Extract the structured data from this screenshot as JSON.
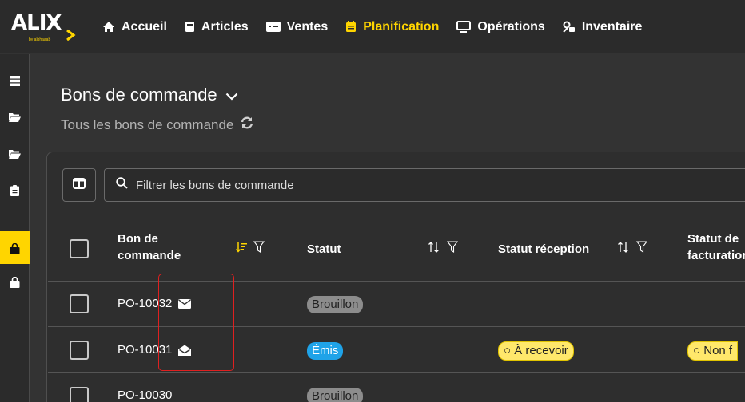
{
  "logo": {
    "text": "ALIX",
    "subtitle": "by alphaaab"
  },
  "nav": [
    {
      "label": "Accueil",
      "icon": "home-icon"
    },
    {
      "label": "Articles",
      "icon": "book-icon"
    },
    {
      "label": "Ventes",
      "icon": "sales-icon"
    },
    {
      "label": "Planification",
      "icon": "calendar-icon",
      "active": true
    },
    {
      "label": "Opérations",
      "icon": "monitor-icon"
    },
    {
      "label": "Inventaire",
      "icon": "inventory-icon"
    }
  ],
  "sidebar": {
    "items": [
      "list-icon",
      "folder-open-icon",
      "folder-open-icon",
      "clipboard-icon",
      "shopping-bag-icon",
      "shopping-bag-icon"
    ],
    "active_index": 4
  },
  "page": {
    "title": "Bons de commande",
    "subtitle": "Tous les bons de commande"
  },
  "filter": {
    "placeholder": "Filtrer les bons de commande"
  },
  "columns": [
    {
      "label": "Bon de commande"
    },
    {
      "label": "Statut"
    },
    {
      "label": "Statut réception"
    },
    {
      "label": "Statut de facturation"
    }
  ],
  "rows": [
    {
      "id": "PO-10032",
      "mail_icon": "envelope-closed-icon",
      "statut": "Brouillon",
      "statut_reception": "",
      "statut_facturation": ""
    },
    {
      "id": "PO-10031",
      "mail_icon": "envelope-open-icon",
      "statut": "Émis",
      "statut_reception": "À recevoir",
      "statut_facturation": "Non f"
    },
    {
      "id": "PO-10030",
      "mail_icon": "",
      "statut": "Brouillon",
      "statut_reception": "",
      "statut_facturation": ""
    }
  ],
  "colors": {
    "accent": "#ffd500",
    "background": "#333333",
    "topbar": "#2b2b2b",
    "pill_blue": "#1fa3e8",
    "pill_grey": "#8c8c8c",
    "pill_yellow": "#ffe86b",
    "highlight": "#e02020"
  }
}
